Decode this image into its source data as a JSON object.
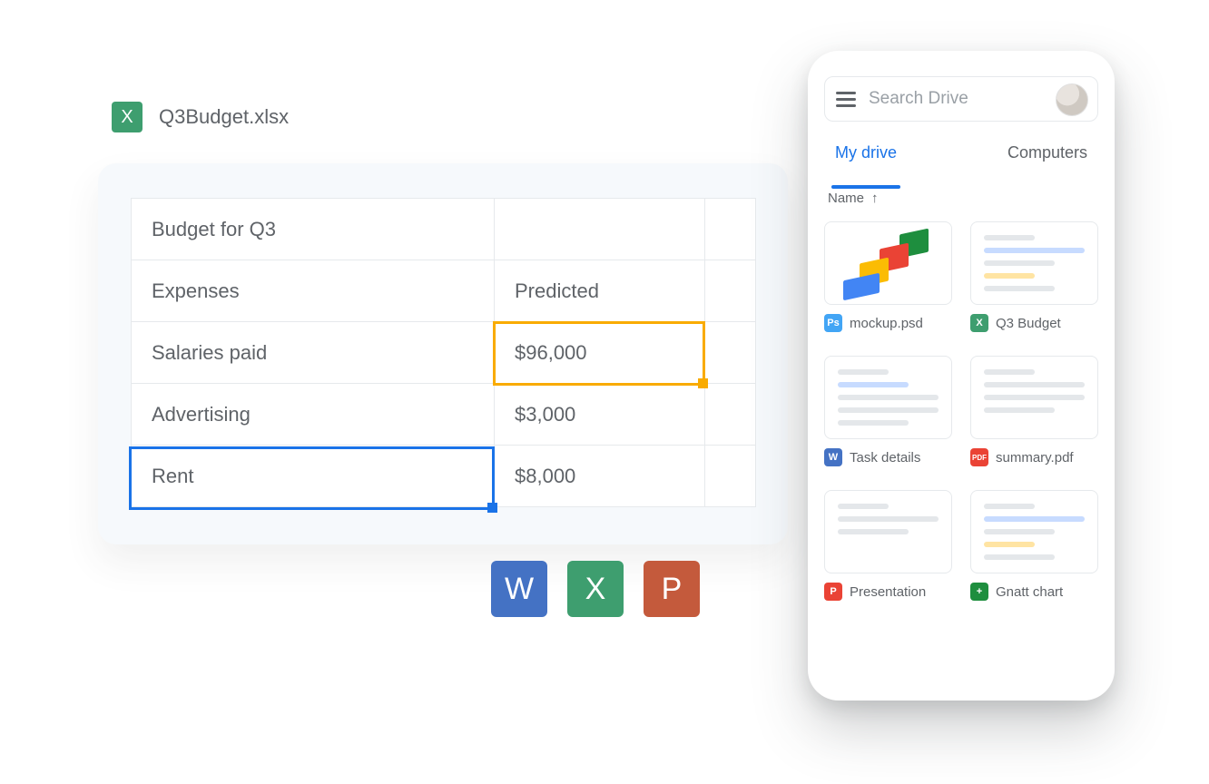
{
  "spreadsheet": {
    "filename": "Q3Budget.xlsx",
    "app_letter": "X",
    "rows": [
      [
        "Budget for Q3",
        ""
      ],
      [
        "Expenses",
        "Predicted"
      ],
      [
        "Salaries paid",
        "$96,000"
      ],
      [
        "Advertising",
        "$3,000"
      ],
      [
        "Rent",
        "$8,000"
      ]
    ]
  },
  "office_buttons": {
    "word": "W",
    "excel": "X",
    "powerpoint": "P"
  },
  "drive": {
    "search_placeholder": "Search Drive",
    "tabs": {
      "my_drive": "My drive",
      "computers": "Computers"
    },
    "sort_label": "Name",
    "sort_arrow": "↑",
    "tiles": [
      {
        "label": "mockup.psd",
        "badge": "Ps",
        "badge_class": "b-ps",
        "thumb": "blocks"
      },
      {
        "label": "Q3 Budget",
        "badge": "X",
        "badge_class": "b-x",
        "thumb": "sheet"
      },
      {
        "label": "Task details",
        "badge": "W",
        "badge_class": "b-w",
        "thumb": "doc"
      },
      {
        "label": "summary.pdf",
        "badge": "PDF",
        "badge_class": "b-pdf",
        "thumb": "plain"
      },
      {
        "label": "Presentation",
        "badge": "P",
        "badge_class": "b-p",
        "thumb": "plain"
      },
      {
        "label": "Gnatt chart",
        "badge": "+",
        "badge_class": "b-sheet",
        "thumb": "sheet"
      }
    ]
  }
}
